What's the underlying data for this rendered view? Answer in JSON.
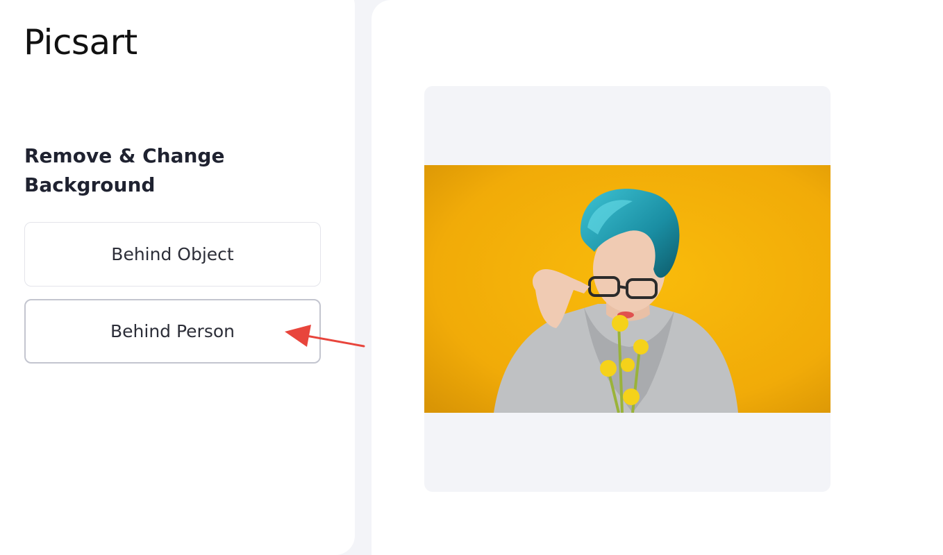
{
  "logo": {
    "text": "Picsart"
  },
  "sidebar": {
    "title_line1": "Remove & Change",
    "title_line2": "Background",
    "options": [
      {
        "label": "Behind Object"
      },
      {
        "label": "Behind Person"
      }
    ]
  },
  "preview": {
    "background_color": "#f7b708",
    "image_description_icon": "person-with-blue-hair-icon"
  },
  "colors": {
    "accent_arrow": "#e8453c",
    "page_background": "#f3f4f8",
    "panel_background": "#ffffff"
  }
}
